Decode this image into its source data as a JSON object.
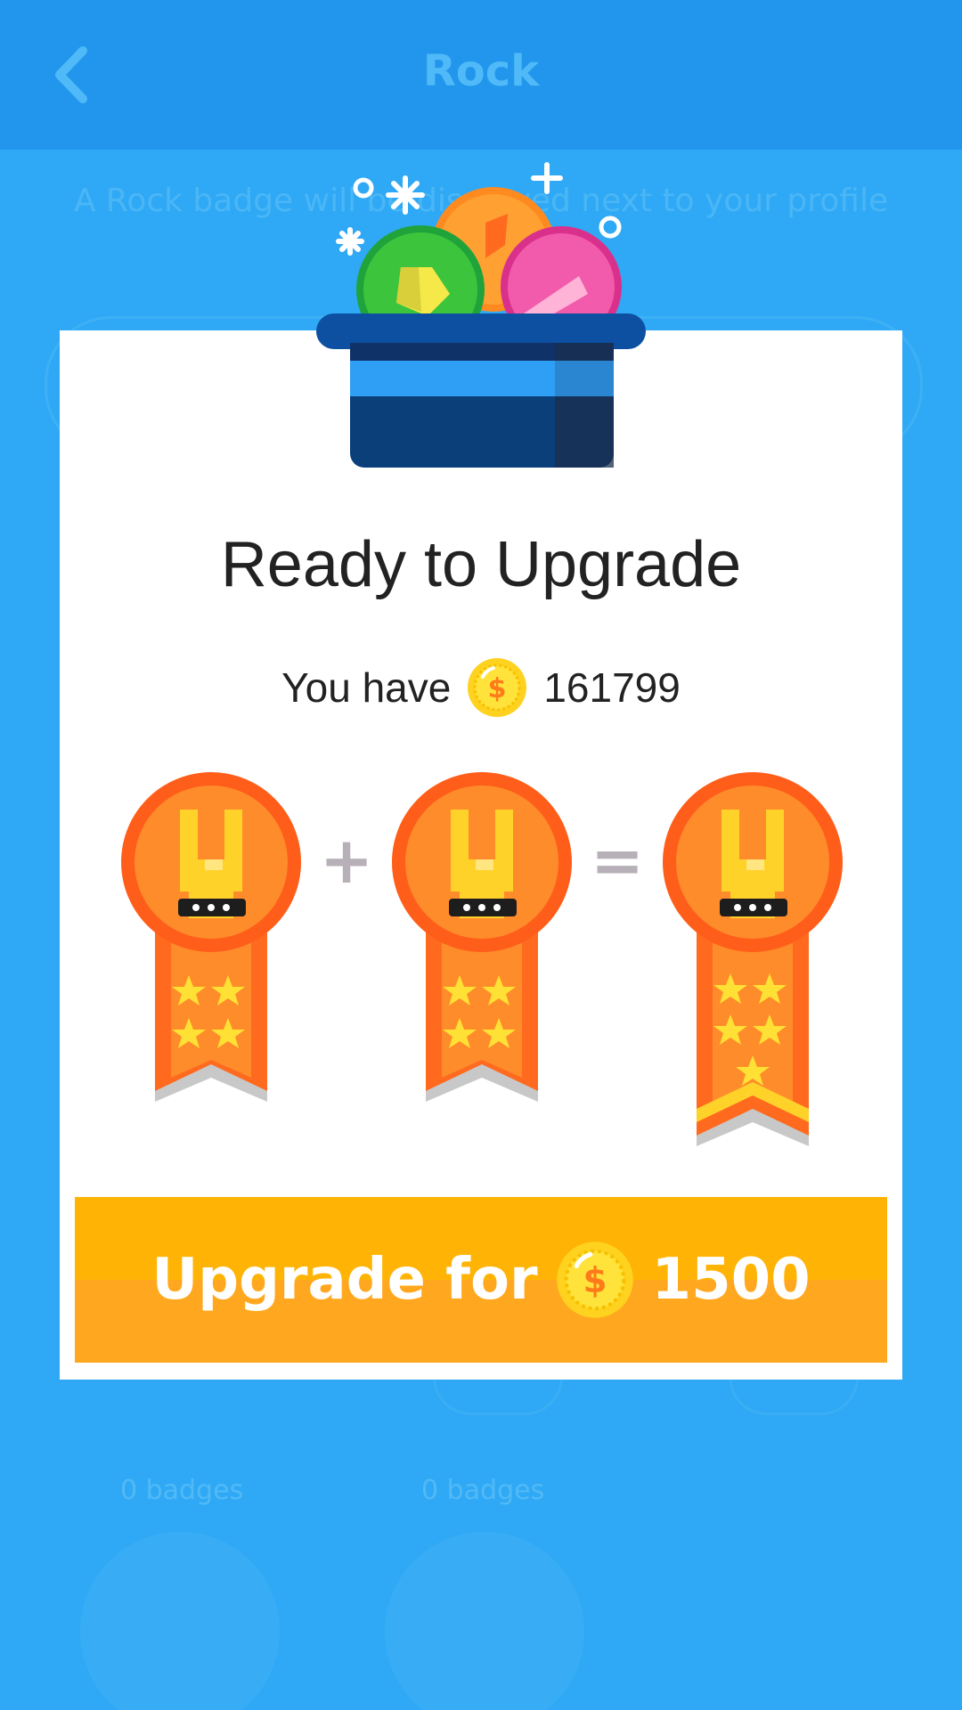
{
  "header": {
    "title": "Rock",
    "back_icon": "chevron-left-icon"
  },
  "background": {
    "subtitle": "A Rock badge will be displayed next to your profile",
    "badge_counts": [
      "0 badges",
      "0 badges"
    ]
  },
  "modal": {
    "title": "Ready to Upgrade",
    "balance_prefix": "You have",
    "balance_value": "161799",
    "coin_icon": "dollar-coin-icon",
    "plus_symbol": "+",
    "equals_symbol": "=",
    "badges": [
      {
        "name": "rock-badge",
        "stars": 4
      },
      {
        "name": "rock-badge",
        "stars": 4
      },
      {
        "name": "rock-badge-upgraded",
        "stars": 5
      }
    ],
    "upgrade_button": {
      "label": "Upgrade for",
      "price": "1500"
    }
  },
  "colors": {
    "background": "#2fa9f5",
    "topbar": "#2196ec",
    "button": "#ffb405",
    "badge_orange": "#ff6a1f",
    "badge_inner": "#ff8c2a",
    "coin": "#ffd21f"
  }
}
